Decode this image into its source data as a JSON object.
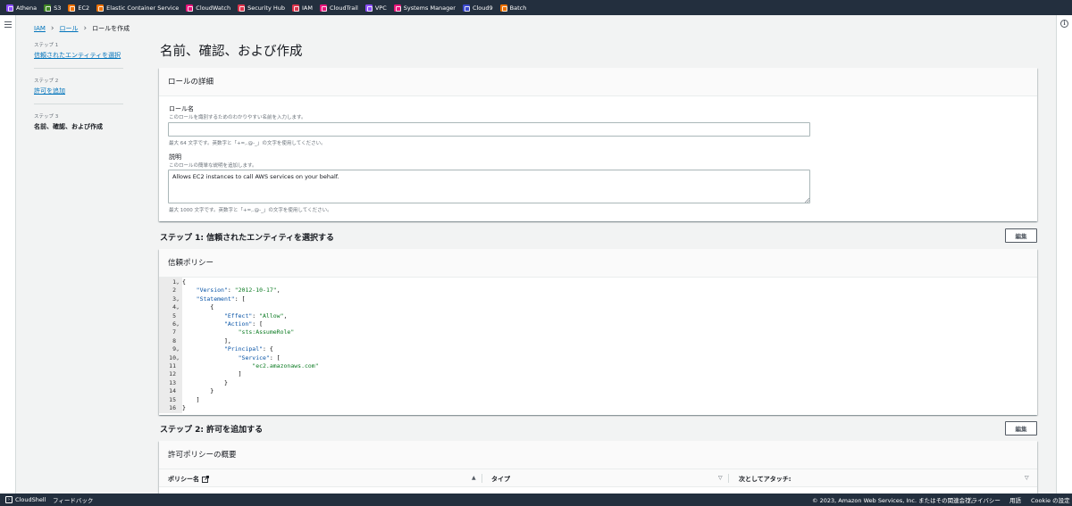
{
  "favorites": [
    {
      "label": "Athena",
      "color": "#8c4fff"
    },
    {
      "label": "S3",
      "color": "#3f8624"
    },
    {
      "label": "EC2",
      "color": "#ed7100"
    },
    {
      "label": "Elastic Container Service",
      "color": "#ed7100"
    },
    {
      "label": "CloudWatch",
      "color": "#e7157b"
    },
    {
      "label": "Security Hub",
      "color": "#dd344c"
    },
    {
      "label": "IAM",
      "color": "#dd344c"
    },
    {
      "label": "CloudTrail",
      "color": "#e7157b"
    },
    {
      "label": "VPC",
      "color": "#8c4fff"
    },
    {
      "label": "Systems Manager",
      "color": "#e7157b"
    },
    {
      "label": "Cloud9",
      "color": "#3b48cc"
    },
    {
      "label": "Batch",
      "color": "#ed7100"
    }
  ],
  "breadcrumb": {
    "iam": "IAM",
    "roles": "ロール",
    "current": "ロールを作成"
  },
  "steps": [
    {
      "num": "ステップ 1",
      "label": "信頼されたエンティティを選択"
    },
    {
      "num": "ステップ 2",
      "label": "許可を追加"
    },
    {
      "num": "ステップ 3",
      "label": "名前、確認、および作成"
    }
  ],
  "page_title": "名前、確認、および作成",
  "details": {
    "header": "ロールの詳細",
    "name_label": "ロール名",
    "name_desc": "このロールを識別するためのわかりやすい名前を入力します。",
    "name_value": "",
    "name_hint": "最大 64 文字です。英数字と「+=,.@-_」の文字を使用してください。",
    "desc_label": "説明",
    "desc_desc": "このロールの簡単な説明を追加します。",
    "desc_value": "Allows EC2 instances to call AWS services on your behalf.",
    "desc_hint": "最大 1000 文字です。英数字と「+=,.@-_」の文字を使用してください。"
  },
  "step1": {
    "title": "ステップ 1: 信頼されたエンティティを選択する",
    "edit": "編集"
  },
  "trust": {
    "header": "信頼ポリシー"
  },
  "step2": {
    "title": "ステップ 2: 許可を追加する",
    "edit": "編集"
  },
  "perm": {
    "header": "許可ポリシーの概要",
    "columns": [
      "ポリシー名",
      "タイプ",
      "次としてアタッチ:"
    ]
  },
  "footer": {
    "cloudshell": "CloudShell",
    "feedback": "フィードバック",
    "copyright": "© 2023, Amazon Web Services, Inc. またはその関連会社。",
    "privacy": "プライバシー",
    "terms": "用語",
    "cookie": "Cookie の設定"
  }
}
